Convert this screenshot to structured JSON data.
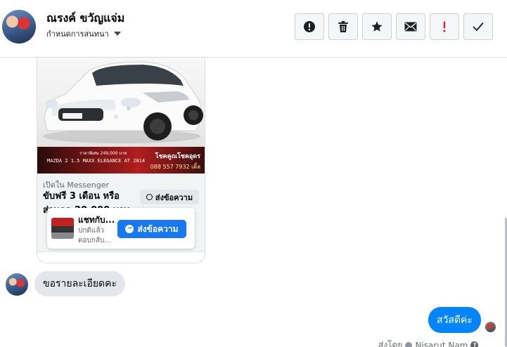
{
  "header": {
    "contact_name": "ณรงค์ ขวัญแจ่ม",
    "assign_label": "กำหนดการสนทนา"
  },
  "toolbar": {
    "buttons": [
      {
        "name": "report-spam-button",
        "icon": "exclamation-circle-icon"
      },
      {
        "name": "delete-button",
        "icon": "trash-icon"
      },
      {
        "name": "star-button",
        "icon": "star-icon"
      },
      {
        "name": "mark-unread-button",
        "icon": "envelope-icon"
      },
      {
        "name": "follow-up-button",
        "icon": "exclamation-icon",
        "color": "#e41e3f"
      },
      {
        "name": "mark-done-button",
        "icon": "checkmark-icon"
      }
    ]
  },
  "shared_post": {
    "banner_price": "ราคาพิเศษ 249,000 บาท",
    "banner_right_1": "โชคคูณโชคอุดร",
    "banner_right_2": "088 557 7932 เติ้ล",
    "banner_left": "MAZDA 2 1.5 MAXX ELEGANCE AT 2014",
    "open_in": "เปิดใน Messenger",
    "title_line_1": "ขับฟรี 3 เดือน หรือ",
    "title_line_2": "ส่วนลด 20,000 บาท",
    "send_message_label": "ส่งข้อความ",
    "mini_card": {
      "title": "แชทกับ...",
      "line_1": "ปกติแล้ว",
      "line_2": "ตอบกลับ...",
      "button_label": "ส่งข้อความ"
    }
  },
  "messages": [
    {
      "direction": "in",
      "text": "ขอรายละเอียดคะ"
    },
    {
      "direction": "out",
      "text": "สวัสดีค่ะ"
    }
  ],
  "sent_by": {
    "prefix": "ส่งโดย",
    "name": "Nisarut Nam"
  },
  "colors": {
    "accent_blue": "#0084ff",
    "button_blue": "#1877f2",
    "alert_red": "#e41e3f"
  }
}
